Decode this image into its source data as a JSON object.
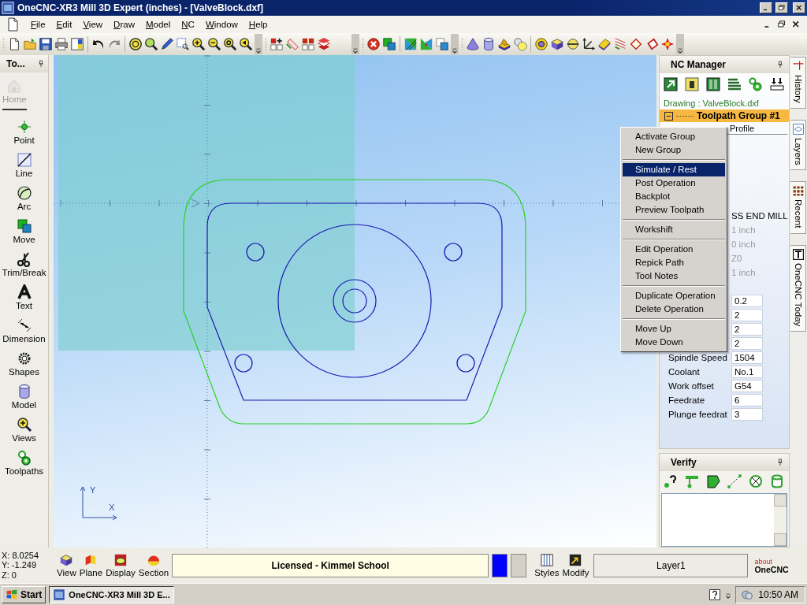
{
  "window": {
    "title": "OneCNC-XR3 Mill 3D Expert (inches) - [ValveBlock.dxf]"
  },
  "menu_bar": [
    "File",
    "Edit",
    "View",
    "Draw",
    "Model",
    "NC",
    "Window",
    "Help"
  ],
  "tool_panel": {
    "title": "To...",
    "items": [
      {
        "label": "Home",
        "disabled": true
      },
      {
        "label": "Point",
        "disabled": false
      },
      {
        "label": "Line",
        "disabled": false
      },
      {
        "label": "Arc",
        "disabled": false
      },
      {
        "label": "Move",
        "disabled": false
      },
      {
        "label": "Trim/Break",
        "disabled": false
      },
      {
        "label": "Text",
        "disabled": false
      },
      {
        "label": "Dimension",
        "disabled": false
      },
      {
        "label": "Shapes",
        "disabled": false
      },
      {
        "label": "Model",
        "disabled": false
      },
      {
        "label": "Views",
        "disabled": false
      },
      {
        "label": "Toolpaths",
        "disabled": false
      }
    ]
  },
  "canvas": {
    "axis_labels": [
      "Y",
      "X"
    ]
  },
  "nc_manager": {
    "title": "NC Manager",
    "drawing": "Drawing : ValveBlock.dxf",
    "group": {
      "label": "Toolpath Group #1",
      "expanded": true
    },
    "operation": "Profile",
    "properties": [
      {
        "value": "SS END MILL",
        "kind": "text",
        "disabled": false
      },
      {
        "value": "1 inch",
        "kind": "text",
        "disabled": true
      },
      {
        "value": "0 inch",
        "kind": "text",
        "disabled": true
      },
      {
        "value": "Z0",
        "kind": "text",
        "disabled": true
      },
      {
        "value": "1 inch",
        "kind": "text",
        "disabled": true
      },
      {
        "value": "0.2",
        "kind": "field",
        "disabled": false
      },
      {
        "value": "2",
        "kind": "field",
        "disabled": false
      },
      {
        "value": "2",
        "kind": "field",
        "disabled": false
      },
      {
        "value": "2",
        "kind": "field",
        "disabled": false
      },
      {
        "label": "Spindle Speed",
        "value": "1504",
        "kind": "field",
        "disabled": false
      },
      {
        "label": "Coolant",
        "value": "No.1",
        "kind": "field",
        "disabled": false
      },
      {
        "label": "Work offset",
        "value": "G54",
        "kind": "field",
        "disabled": false
      },
      {
        "label": "Feedrate",
        "value": "6",
        "kind": "field",
        "disabled": false
      },
      {
        "label": "Plunge feedrat",
        "value": "3",
        "kind": "field",
        "disabled": false
      }
    ]
  },
  "context_menu": {
    "groups": [
      {
        "items": [
          {
            "label": "Activate Group",
            "selected": false
          },
          {
            "label": "New Group",
            "selected": false
          }
        ]
      },
      {
        "items": [
          {
            "label": "Simulate / Rest",
            "selected": true
          },
          {
            "label": "Post Operation",
            "selected": false
          },
          {
            "label": "Backplot",
            "selected": false
          },
          {
            "label": "Preview Toolpath",
            "selected": false
          }
        ]
      },
      {
        "items": [
          {
            "label": "Workshift",
            "selected": false
          }
        ]
      },
      {
        "items": [
          {
            "label": "Edit Operation",
            "selected": false
          },
          {
            "label": "Repick Path",
            "selected": false
          },
          {
            "label": "Tool Notes",
            "selected": false
          }
        ]
      },
      {
        "items": [
          {
            "label": "Duplicate Operation",
            "selected": false
          },
          {
            "label": "Delete Operation",
            "selected": false
          }
        ]
      },
      {
        "items": [
          {
            "label": "Move Up",
            "selected": false
          },
          {
            "label": "Move Down",
            "selected": false
          }
        ]
      }
    ]
  },
  "verify": {
    "title": "Verify"
  },
  "side_tabs": [
    "History",
    "Layers",
    "Recent",
    "OneCNC Today"
  ],
  "status_bar": {
    "coordinates": [
      "X: 8.0254",
      "Y: -1.249",
      "Z: 0"
    ],
    "buttons": [
      "View",
      "Plane",
      "Display",
      "Section"
    ],
    "license": "Licensed - Kimmel School",
    "swatches": [
      {
        "color": "#0000ff"
      },
      {
        "color": "#d4d0c8"
      }
    ],
    "tools": [
      "Styles",
      "Modify"
    ],
    "layer": "Layer1",
    "logo": {
      "top": "about",
      "bottom": "OneCNC"
    }
  },
  "taskbar": {
    "start": "Start",
    "tasks": [
      {
        "label": "OneCNC-XR3 Mill 3D E...",
        "selected": true
      }
    ],
    "clock": "10:50 AM"
  }
}
